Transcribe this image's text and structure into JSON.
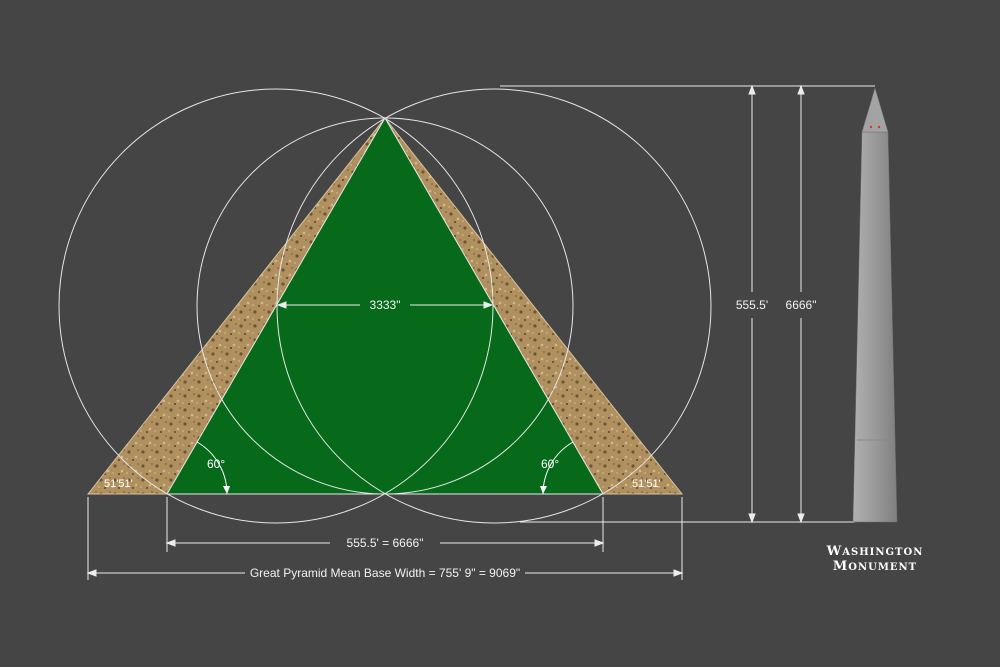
{
  "labels": {
    "inner_width": "3333\"",
    "height_feet": "555.5'",
    "height_inches": "6666\"",
    "base_inner": "555.5' = 6666\"",
    "base_full": "Great Pyramid Mean Base Width  = 755' 9\" = 9069\"",
    "angle_left": "60°",
    "angle_right": "60°",
    "slope_left": "51'51'",
    "slope_right": "51'51'"
  },
  "monument": {
    "line1_cap": "W",
    "line1_rest": "ASHINGTON",
    "line2_cap": "M",
    "line2_rest": "ONUMENT"
  },
  "colors": {
    "background": "#454545",
    "triangle_green": "#076a1b",
    "sand": "#b39466",
    "obelisk": "#9a9a9a",
    "lines": "#ececec"
  }
}
